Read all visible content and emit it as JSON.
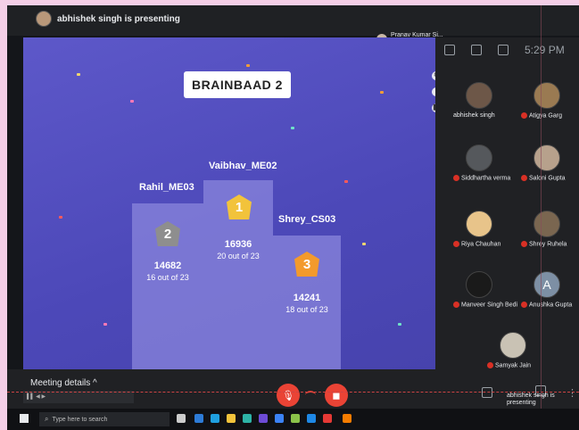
{
  "topbar": {
    "presenting": "abhishek singh is presenting",
    "participants_pill": "Pranav Kumar Si... and 13 more"
  },
  "side_panel": {
    "time": "5:29 PM"
  },
  "quiz": {
    "title": "BRAINBAAD 2",
    "podium": [
      {
        "rank": "2",
        "name": "Rahil_ME03",
        "score": "14682",
        "detail": "16 out of 23"
      },
      {
        "rank": "1",
        "name": "Vaibhav_ME02",
        "score": "16936",
        "detail": "20 out of 23"
      },
      {
        "rank": "3",
        "name": "Shrey_CS03",
        "score": "14241",
        "detail": "18 out of 23"
      }
    ]
  },
  "people": [
    {
      "name": "abhishek singh"
    },
    {
      "name": "Atigya Garg"
    },
    {
      "name": "Siddhartha verma"
    },
    {
      "name": "Saloni Gupta"
    },
    {
      "name": "Riya Chauhan"
    },
    {
      "name": "Shrey Ruhela"
    },
    {
      "name": "Manveer Singh Bedi"
    },
    {
      "name": "Anushka Gupta"
    },
    {
      "name": "Samyak Jain"
    }
  ],
  "bottom": {
    "meeting_details": "Meeting details",
    "status": "abhishek singh is presenting"
  },
  "taskbar": {
    "search_placeholder": "Type here to search"
  },
  "colors": {
    "stage": "#4f4bbb",
    "mic_off": "#d93025",
    "end_call": "#ea4335"
  }
}
